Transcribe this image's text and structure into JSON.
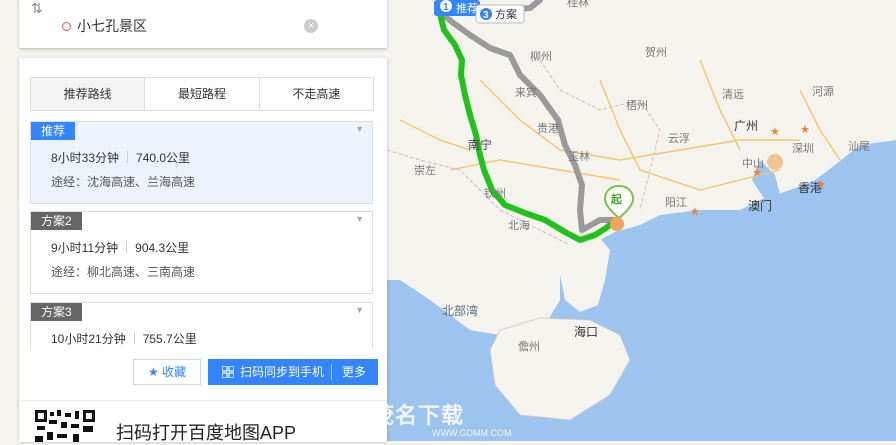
{
  "search": {
    "destination": "小七孔景区",
    "swap_icon": "swap-icon",
    "clear_icon": "clear-icon"
  },
  "tabs": [
    {
      "label": "推荐路线",
      "active": true
    },
    {
      "label": "最短路程",
      "active": false
    },
    {
      "label": "不走高速",
      "active": false
    }
  ],
  "routes": [
    {
      "tag": "推荐",
      "duration": "8小时33分钟",
      "distance": "740.0公里",
      "via": "途经：沈海高速、兰海高速",
      "active": true
    },
    {
      "tag": "方案2",
      "duration": "9小时11分钟",
      "distance": "904.3公里",
      "via": "途经：柳北高速、三南高速",
      "active": false
    },
    {
      "tag": "方案3",
      "duration": "10小时21分钟",
      "distance": "755.7公里",
      "via": "",
      "active": false
    }
  ],
  "actions": {
    "favorite": "收藏",
    "sync": "扫码同步到手机",
    "more": "更多"
  },
  "qr": {
    "text": "扫码打开百度地图APP"
  },
  "map": {
    "route_markers": [
      {
        "num": "1",
        "label": "推荐"
      },
      {
        "num": "3",
        "label": "方案"
      }
    ],
    "start_label": "起",
    "cities": [
      "广州",
      "中山",
      "澳门",
      "香港",
      "深圳",
      "海口",
      "南宁",
      "钦州",
      "北海",
      "阳江",
      "梧州",
      "贵港",
      "柳州",
      "贺州",
      "清远",
      "河源",
      "汕尾",
      "云浮",
      "玉林",
      "崇左",
      "来宾",
      "桂林",
      "儋州"
    ],
    "sea_labels": [
      "北部湾"
    ],
    "watermark": "茂名下载",
    "watermark_url": "WWW.GDMM.COM",
    "colors": {
      "route_main": "#22c21c",
      "route_alt": "#9a9a9a",
      "accent": "#3385ff",
      "sea": "#9cc4ef",
      "land": "#f5f3ee"
    }
  }
}
